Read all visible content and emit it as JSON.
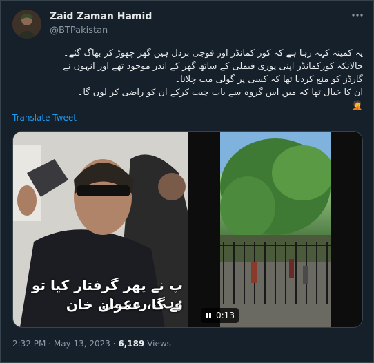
{
  "author": {
    "name": "Zaid Zaman Hamid",
    "handle": "@BTPakistan"
  },
  "tweet": {
    "lines": [
      "یہ کمینہ کہہ رہا ہے کہ کور کمانڈر اور فوجی بزدل ہیں گھر چھوڑ کر بھاگ گئے۔",
      "حالانکہ کورکمانڈر اپنی پوری فیملی کے ساتھ گھر کے اندر موجود تھے اور انہوں نے",
      "گارڈز کو منع کردیا تھا کہ کسی پر گولی مت چلانا۔",
      "ان کا خیال تھا کہ میں اس گروہ سے بات چیت کرکے ان کو راضی کر لوں گا۔",
      "🤦"
    ],
    "translate_label": "Translate Tweet"
  },
  "media": {
    "caption_line1": "پ نے پھر گرفتار کیا تو وہی ردعمل",
    "caption_line2": "ئے گا، عمران خان",
    "time": "0:13"
  },
  "meta": {
    "time": "2:32 PM",
    "separator": "·",
    "date": "May 13, 2023",
    "views_count": "6,189",
    "views_label": "Views"
  }
}
